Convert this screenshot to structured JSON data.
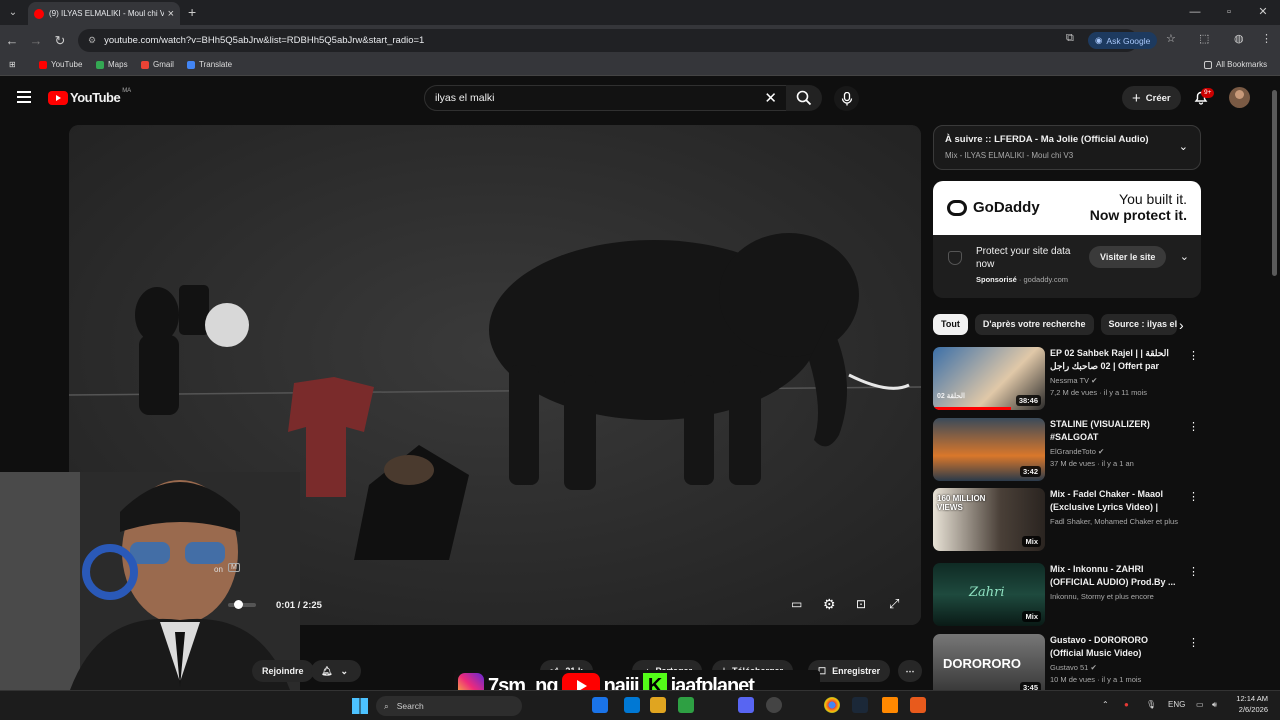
{
  "browser": {
    "tab_title": "(9) ILYAS ELMALIKI - Moul chi V",
    "url": "youtube.com/watch?v=BHh5Q5abJrw&list=RDBHh5Q5abJrw&start_radio=1",
    "ask_google": "Ask Google",
    "bookmarks": [
      "YouTube",
      "Maps",
      "Gmail",
      "Translate"
    ],
    "all_bookmarks": "All Bookmarks"
  },
  "youtube": {
    "logo": "YouTube",
    "country": "MA",
    "search_value": "ilyas el malki",
    "create_label": "Créer",
    "notif_count": "9+"
  },
  "player": {
    "time": "0:01 / 2:25",
    "channel_badge": "M",
    "channel_partial": "on"
  },
  "below_video": {
    "join": "Rejoindre",
    "likes": "21 k",
    "share": "Partager",
    "download": "Télécharger",
    "save": "Enregistrer"
  },
  "up_next": {
    "title": "À suivre :: LFERDA - Ma Jolie (Official Audio)",
    "subtitle": "Mix - ILYAS ELMALIKI - Moul chi V3"
  },
  "ad": {
    "brand": "GoDaddy",
    "slogan_1": "You built it.",
    "slogan_2": "Now protect it.",
    "text": "Protect your site data now",
    "sponsored": "Sponsorisé",
    "domain": "godaddy.com",
    "cta": "Visiter le site"
  },
  "chips": [
    "Tout",
    "D'après votre recherche",
    "Source : ilyas el"
  ],
  "recommendations": [
    {
      "title": "EP 02 Sahbek Rajel | | الحلقة 02 صاحبك راجل | Offert par Raksha.tn",
      "channel": "Nessma TV",
      "meta": "7,2 M de vues · il y a 11 mois",
      "duration": "38:46",
      "thumb_text": "الحلقة 02",
      "color": "#3b6fa8"
    },
    {
      "title": "STALINE (VISUALIZER) #SALGOAT",
      "channel": "ElGrandeToto",
      "meta": "37 M de vues · il y a 1 an",
      "duration": "3:42",
      "thumb_text": "",
      "color": "#d9772b"
    },
    {
      "title": "Mix - Fadel Chaker - Maaol (Exclusive Lyrics Video) | فضل ...",
      "channel": "Fadl Shaker, Mohamed Chaker et plus en...",
      "meta": "",
      "duration": "Mix",
      "thumb_text": "160 MILLION VIEWS",
      "color": "#4a4038"
    },
    {
      "title": "Mix - Inkonnu - ZAHRI (OFFICIAL AUDIO) Prod.By ...",
      "channel": "Inkonnu, Stormy et plus encore",
      "meta": "",
      "duration": "Mix",
      "thumb_text": "Zahri",
      "color": "#1e4a3e"
    },
    {
      "title": "Gustavo - DORORORO (Official Music Video)",
      "channel": "Gustavo 51",
      "meta": "10 M de vues · il y a 1 mois",
      "duration": "3:45",
      "thumb_text": "DORORORO",
      "color": "#555555"
    }
  ],
  "overlay": {
    "text1": "7sm_ng",
    "text2": "najjj",
    "text3": "jaafplanet"
  },
  "taskbar": {
    "search": "Search",
    "lang": "ENG",
    "time": "12:14 AM",
    "date": "2/6/2026"
  }
}
